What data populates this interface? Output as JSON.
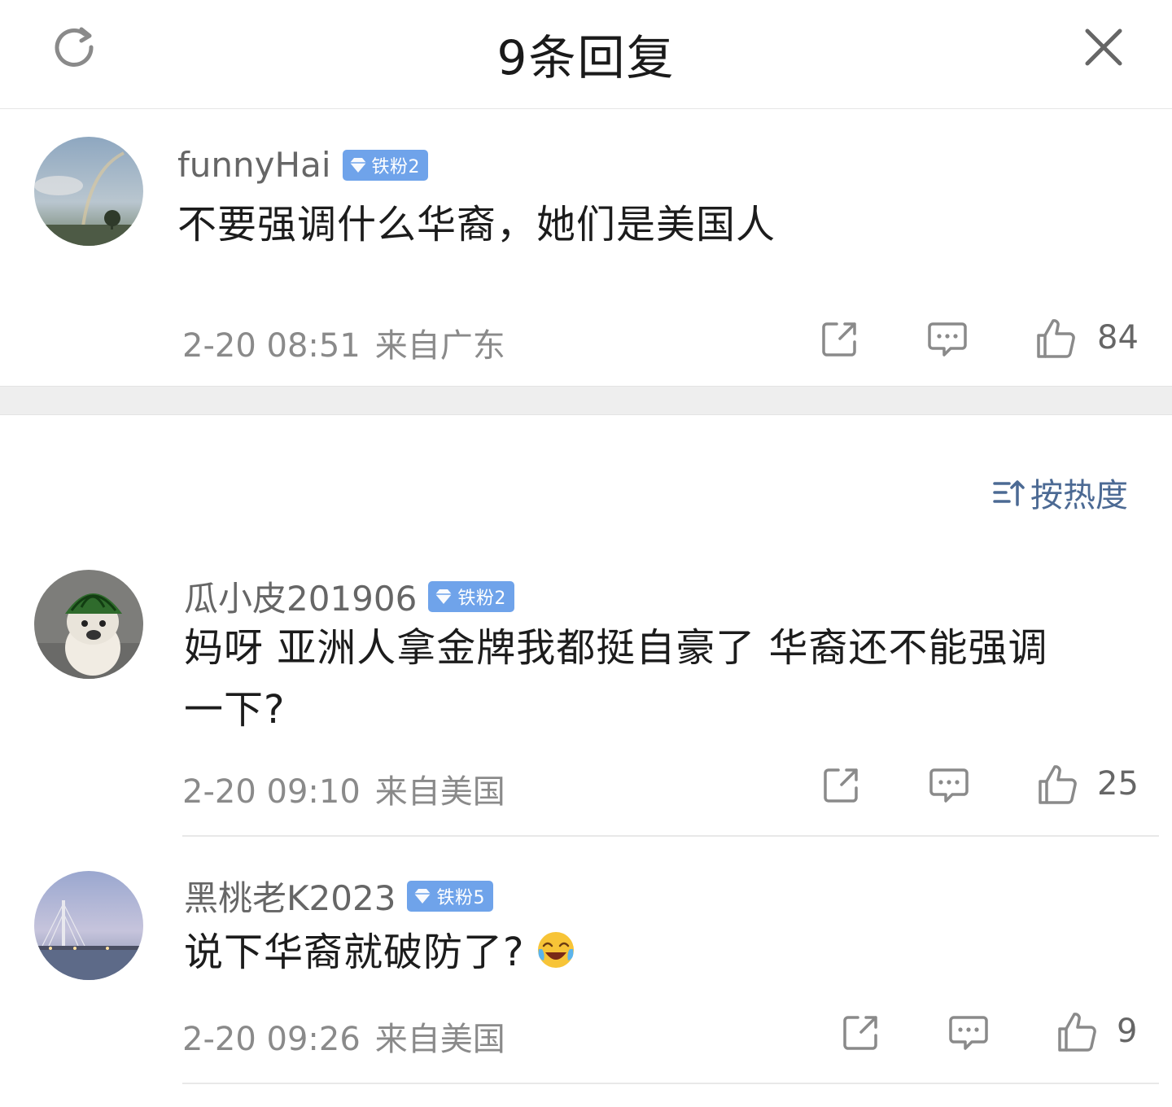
{
  "header": {
    "title": "9条回复",
    "refresh_icon": "refresh-icon",
    "close_icon": "close-icon"
  },
  "sort": {
    "label": "按热度",
    "icon": "sort-icon"
  },
  "root_comment": {
    "username": "funnyHai",
    "badge": "铁粉2",
    "text": "不要强调什么华裔，她们是美国人",
    "time": "2-20 08:51",
    "location": "来自广东",
    "likes": "84"
  },
  "replies": [
    {
      "username": "瓜小皮201906",
      "badge": "铁粉2",
      "text_line1": "妈呀 亚洲人拿金牌我都挺自豪了 华裔还不能强调",
      "text_line2": "一下?",
      "time": "2-20 09:10",
      "location": "来自美国",
      "likes": "25"
    },
    {
      "username": "黑桃老K2023",
      "badge": "铁粉5",
      "text": "说下华裔就破防了?",
      "emoji": "laughing-crying-emoji",
      "time": "2-20 09:26",
      "location": "来自美国",
      "likes": "9"
    }
  ],
  "colors": {
    "badge": "#6fa3ea",
    "sort_text": "#4c6a94",
    "meta_text": "#8a8a8a"
  }
}
